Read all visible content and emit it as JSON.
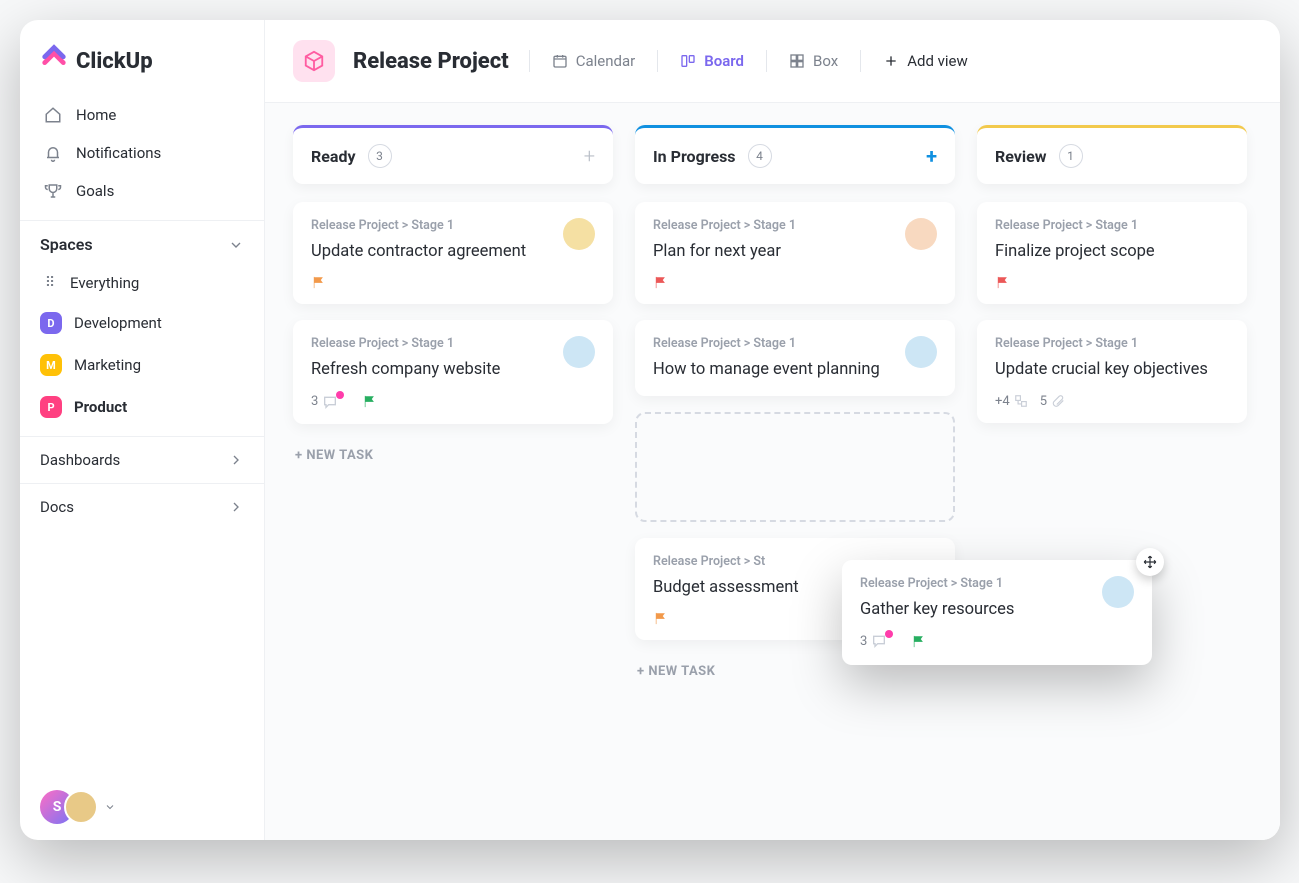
{
  "brand": "ClickUp",
  "nav": {
    "home": "Home",
    "notifications": "Notifications",
    "goals": "Goals"
  },
  "sections": {
    "spaces_label": "Spaces",
    "everything": "Everything",
    "spaces": [
      {
        "letter": "D",
        "label": "Development"
      },
      {
        "letter": "M",
        "label": "Marketing"
      },
      {
        "letter": "P",
        "label": "Product"
      }
    ],
    "dashboards": "Dashboards",
    "docs": "Docs"
  },
  "user_initial": "S",
  "topbar": {
    "project": "Release Project",
    "views": {
      "calendar": "Calendar",
      "board": "Board",
      "box": "Box",
      "add": "Add view"
    }
  },
  "board": {
    "breadcrumb": "Release Project > Stage 1",
    "new_task": "+ NEW TASK",
    "columns": {
      "ready": {
        "title": "Ready",
        "count": "3"
      },
      "inprog": {
        "title": "In Progress",
        "count": "4"
      },
      "review": {
        "title": "Review",
        "count": "1"
      }
    },
    "cards": {
      "c1": {
        "title": "Update contractor agreement"
      },
      "c2": {
        "title": "Refresh company website",
        "comments": "3"
      },
      "c3": {
        "title": "Plan for next year"
      },
      "c4": {
        "title": "How to manage event planning"
      },
      "c5": {
        "title": "Budget assessment"
      },
      "c6": {
        "title": "Finalize project scope"
      },
      "c7": {
        "title": "Update crucial key objectives",
        "subtasks_more": "+4",
        "attach": "5"
      },
      "drag": {
        "title": "Gather key resources",
        "comments": "3",
        "breadcrumb_short": "Release Project > St"
      }
    }
  },
  "colors": {
    "flag_orange": "#f2994a",
    "flag_red": "#eb5757",
    "flag_green": "#27ae60"
  }
}
